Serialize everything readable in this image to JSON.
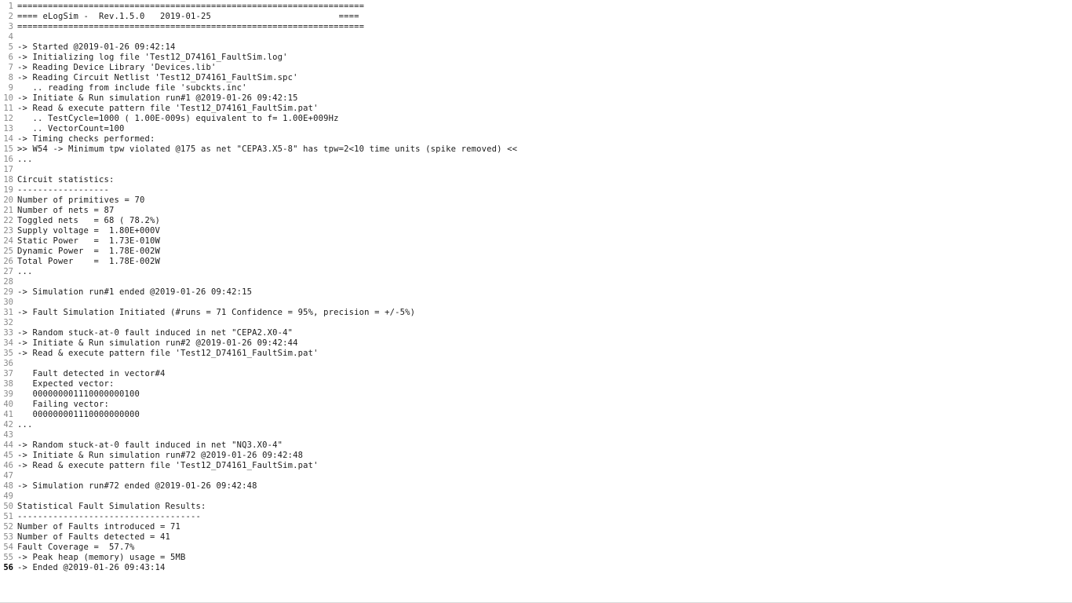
{
  "document": {
    "kind": "log-file",
    "title": "eLogSim log viewer",
    "total_lines": 56,
    "current_line": 56,
    "colors": {
      "background": "#ffffff",
      "text": "#1a1a1a",
      "gutter_text": "#8a8a8a",
      "current_line_gutter_text": "#000000"
    },
    "lines": [
      {
        "n": 1,
        "text": "===================================================================="
      },
      {
        "n": 2,
        "text": "==== eLogSim -  Rev.1.5.0   2019-01-25                         ===="
      },
      {
        "n": 3,
        "text": "===================================================================="
      },
      {
        "n": 4,
        "text": ""
      },
      {
        "n": 5,
        "text": "-> Started @2019-01-26 09:42:14"
      },
      {
        "n": 6,
        "text": "-> Initializing log file 'Test12_D74161_FaultSim.log'"
      },
      {
        "n": 7,
        "text": "-> Reading Device Library 'Devices.lib'"
      },
      {
        "n": 8,
        "text": "-> Reading Circuit Netlist 'Test12_D74161_FaultSim.spc'"
      },
      {
        "n": 9,
        "text": "   .. reading from include file 'subckts.inc'"
      },
      {
        "n": 10,
        "text": "-> Initiate & Run simulation run#1 @2019-01-26 09:42:15"
      },
      {
        "n": 11,
        "text": "-> Read & execute pattern file 'Test12_D74161_FaultSim.pat'"
      },
      {
        "n": 12,
        "text": "   .. TestCycle=1000 ( 1.00E-009s) equivalent to f= 1.00E+009Hz"
      },
      {
        "n": 13,
        "text": "   .. VectorCount=100"
      },
      {
        "n": 14,
        "text": "-> Timing checks performed:"
      },
      {
        "n": 15,
        "text": ">> W54 -> Minimum tpw violated @175 as net \"CEPA3.X5-8\" has tpw=2<10 time units (spike removed) <<"
      },
      {
        "n": 16,
        "text": "..."
      },
      {
        "n": 17,
        "text": ""
      },
      {
        "n": 18,
        "text": "Circuit statistics:"
      },
      {
        "n": 19,
        "text": "------------------"
      },
      {
        "n": 20,
        "text": "Number of primitives = 70"
      },
      {
        "n": 21,
        "text": "Number of nets = 87"
      },
      {
        "n": 22,
        "text": "Toggled nets   = 68 ( 78.2%)"
      },
      {
        "n": 23,
        "text": "Supply voltage =  1.80E+000V"
      },
      {
        "n": 24,
        "text": "Static Power   =  1.73E-010W"
      },
      {
        "n": 25,
        "text": "Dynamic Power  =  1.78E-002W"
      },
      {
        "n": 26,
        "text": "Total Power    =  1.78E-002W"
      },
      {
        "n": 27,
        "text": "..."
      },
      {
        "n": 28,
        "text": ""
      },
      {
        "n": 29,
        "text": "-> Simulation run#1 ended @2019-01-26 09:42:15"
      },
      {
        "n": 30,
        "text": ""
      },
      {
        "n": 31,
        "text": "-> Fault Simulation Initiated (#runs = 71 Confidence = 95%, precision = +/-5%)"
      },
      {
        "n": 32,
        "text": ""
      },
      {
        "n": 33,
        "text": "-> Random stuck-at-0 fault induced in net \"CEPA2.X0-4\""
      },
      {
        "n": 34,
        "text": "-> Initiate & Run simulation run#2 @2019-01-26 09:42:44"
      },
      {
        "n": 35,
        "text": "-> Read & execute pattern file 'Test12_D74161_FaultSim.pat'"
      },
      {
        "n": 36,
        "text": ""
      },
      {
        "n": 37,
        "text": "   Fault detected in vector#4"
      },
      {
        "n": 38,
        "text": "   Expected vector:"
      },
      {
        "n": 39,
        "text": "   000000001110000000100"
      },
      {
        "n": 40,
        "text": "   Failing vector:"
      },
      {
        "n": 41,
        "text": "   000000001110000000000"
      },
      {
        "n": 42,
        "text": "..."
      },
      {
        "n": 43,
        "text": ""
      },
      {
        "n": 44,
        "text": "-> Random stuck-at-0 fault induced in net \"NQ3.X0-4\""
      },
      {
        "n": 45,
        "text": "-> Initiate & Run simulation run#72 @2019-01-26 09:42:48"
      },
      {
        "n": 46,
        "text": "-> Read & execute pattern file 'Test12_D74161_FaultSim.pat'"
      },
      {
        "n": 47,
        "text": ""
      },
      {
        "n": 48,
        "text": "-> Simulation run#72 ended @2019-01-26 09:42:48"
      },
      {
        "n": 49,
        "text": ""
      },
      {
        "n": 50,
        "text": "Statistical Fault Simulation Results:"
      },
      {
        "n": 51,
        "text": "------------------------------------"
      },
      {
        "n": 52,
        "text": "Number of Faults introduced = 71"
      },
      {
        "n": 53,
        "text": "Number of Faults detected = 41"
      },
      {
        "n": 54,
        "text": "Fault Coverage =  57.7%"
      },
      {
        "n": 55,
        "text": "-> Peak heap (memory) usage = 5MB"
      },
      {
        "n": 56,
        "text": "-> Ended @2019-01-26 09:43:14"
      }
    ]
  }
}
